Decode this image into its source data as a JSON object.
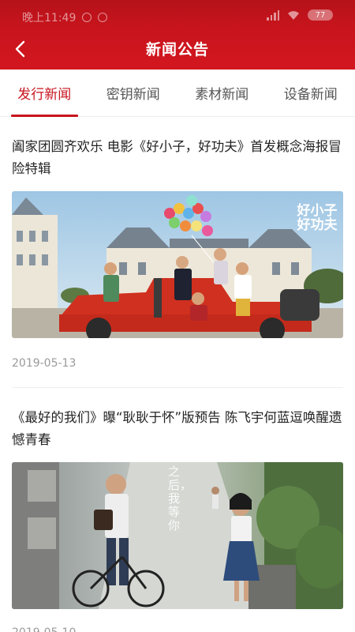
{
  "status_bar": {
    "time": "晚上11:49",
    "battery": "77"
  },
  "header": {
    "title": "新闻公告"
  },
  "tabs": [
    {
      "label": "发行新闻",
      "active": true
    },
    {
      "label": "密钥新闻",
      "active": false
    },
    {
      "label": "素材新闻",
      "active": false
    },
    {
      "label": "设备新闻",
      "active": false
    }
  ],
  "news": [
    {
      "title": "阖家团圆齐欢乐 电影《好小子，好功夫》首发概念海报冒险特辑",
      "date": "2019-05-13",
      "poster_text": "好小子 好功夫"
    },
    {
      "title": "《最好的我们》曝“耿耿于怀”版预告 陈飞宇何蓝逗唤醒遗憾青春",
      "date": "2019-05-10",
      "poster_text": "之后，我等你"
    }
  ],
  "colors": {
    "brand": "#c8141d",
    "active_tab": "#c8141d",
    "date_text": "#9a9a9a"
  }
}
